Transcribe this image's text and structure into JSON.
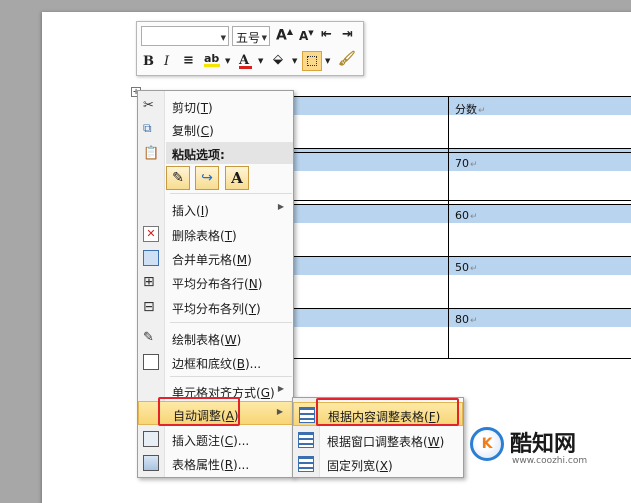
{
  "table": {
    "header_cell": "分数",
    "rows": [
      "70",
      "60",
      "50",
      "80"
    ],
    "para_mark": "↵"
  },
  "mini_toolbar": {
    "font_name": "",
    "font_size": "五号",
    "grow_font": "A",
    "shrink_font": "A",
    "bold": "B",
    "italic": "I",
    "font_color_letter": "A"
  },
  "context_menu": {
    "items": [
      {
        "label": "剪切",
        "accel": "T",
        "icon": "scissors-icon"
      },
      {
        "label": "复制",
        "accel": "C",
        "icon": "copy-icon"
      }
    ],
    "paste_header": "粘贴选项:",
    "paste_options": [
      "keep-source-format",
      "merge-format",
      "text-only"
    ],
    "paste_text_glyph": "A",
    "insert": {
      "label": "插入",
      "accel": "I"
    },
    "delete_table": {
      "label": "删除表格",
      "accel": "T"
    },
    "merge_cells": {
      "label": "合并单元格",
      "accel": "M"
    },
    "distribute_rows": {
      "label": "平均分布各行",
      "accel": "N"
    },
    "distribute_cols": {
      "label": "平均分布各列",
      "accel": "Y"
    },
    "draw_table": {
      "label": "绘制表格",
      "accel": "W"
    },
    "borders": {
      "label": "边框和底纹",
      "accel": "B",
      "suffix": "..."
    },
    "cell_align": {
      "label": "单元格对齐方式",
      "accel": "G"
    },
    "autofit": {
      "label": "自动调整",
      "accel": "A"
    },
    "insert_caption": {
      "label": "插入题注",
      "accel": "C",
      "suffix": "..."
    },
    "table_props": {
      "label": "表格属性",
      "accel": "R",
      "suffix": "..."
    }
  },
  "submenu": {
    "fit_contents": {
      "label": "根据内容调整表格",
      "accel": "F"
    },
    "fit_window": {
      "label": "根据窗口调整表格",
      "accel": "W"
    },
    "fixed_width": {
      "label": "固定列宽",
      "accel": "X"
    }
  },
  "watermark": {
    "name": "酷知网",
    "url": "www.coozhi.com",
    "logo_text": "K"
  },
  "colors": {
    "highlight": "#b9d4ee",
    "menu_hover": "#f8d577",
    "callout_red": "#e2232a",
    "brand_blue": "#2a7fd4"
  }
}
